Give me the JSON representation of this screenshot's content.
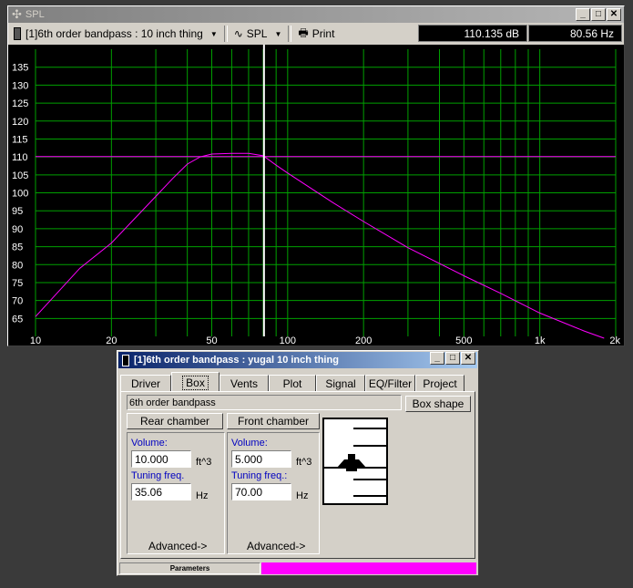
{
  "spl_window": {
    "title": "SPL",
    "project_selector": "[1]6th order bandpass : 10 inch thing",
    "plot_selector": "SPL",
    "print_label": "Print",
    "readout_db": "110.135 dB",
    "readout_hz": "80.56 Hz"
  },
  "chart_data": {
    "type": "line",
    "title": "",
    "xlabel": "",
    "ylabel": "",
    "x_scale": "log",
    "xlim": [
      10,
      2000
    ],
    "ylim": [
      60,
      140
    ],
    "grid": true,
    "x_ticks": [
      {
        "value": 10,
        "label": "10"
      },
      {
        "value": 20,
        "label": "20"
      },
      {
        "value": 50,
        "label": "50"
      },
      {
        "value": 100,
        "label": "100"
      },
      {
        "value": 200,
        "label": "200"
      },
      {
        "value": 500,
        "label": "500"
      },
      {
        "value": 1000,
        "label": "1k"
      },
      {
        "value": 2000,
        "label": "2k"
      }
    ],
    "y_ticks": [
      65,
      70,
      75,
      80,
      85,
      90,
      95,
      100,
      105,
      110,
      115,
      120,
      125,
      130,
      135
    ],
    "series": [
      {
        "color": "#ff00ff",
        "x": [
          10,
          15,
          20,
          30,
          35,
          40,
          45,
          50,
          60,
          70,
          80,
          90,
          100,
          150,
          200,
          300,
          500,
          700,
          1000,
          1500,
          1800
        ],
        "y": [
          65.5,
          79,
          86,
          99,
          104,
          108,
          110,
          110.8,
          111,
          111,
          110.3,
          107.7,
          105.5,
          97.4,
          92,
          84.7,
          76.9,
          72,
          66.5,
          61.5,
          59.5
        ]
      }
    ],
    "reference_line_y": 110.1,
    "cursor_x": 80.56,
    "colors": {
      "background": "#000000",
      "grid": "#00a000",
      "tick_label": "#ffffff"
    }
  },
  "box_window": {
    "title": "[1]6th order bandpass : yugal 10 inch thing",
    "tabs": [
      "Driver",
      "Box",
      "Vents",
      "Plot",
      "Signal",
      "EQ/Filter",
      "Project"
    ],
    "active_tab": "Box",
    "box_type_value": "6th order bandpass",
    "box_shape_label": "Box shape",
    "rear": {
      "title": "Rear chamber",
      "volume_label": "Volume:",
      "volume_value": "10.000",
      "volume_unit": "ft^3",
      "tuning_label": "Tuning freq.",
      "tuning_value": "35.06",
      "tuning_unit": "Hz",
      "advanced": "Advanced->"
    },
    "front": {
      "title": "Front chamber",
      "volume_label": "Volume:",
      "volume_value": "5.000",
      "volume_unit": "ft^3",
      "tuning_label": "Tuning freq.:",
      "tuning_value": "70.00",
      "tuning_unit": "Hz",
      "advanced": "Advanced->"
    },
    "status_label": "Parameters",
    "status_color": "#ff00ff"
  }
}
